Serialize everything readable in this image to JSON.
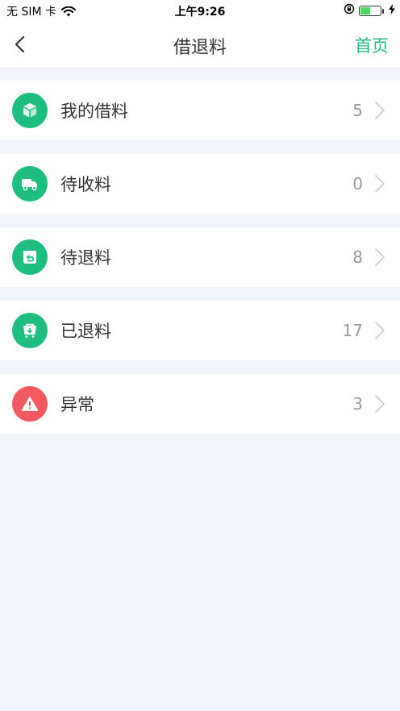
{
  "status_bar": {
    "carrier": "无 SIM 卡",
    "time": "上午9:26",
    "battery_level": 0.55
  },
  "nav": {
    "title": "借退料",
    "home_label": "首页"
  },
  "colors": {
    "accent": "#1fbd7f",
    "danger": "#f25a61"
  },
  "items": [
    {
      "label": "我的借料",
      "count": "5",
      "icon": "box-icon"
    },
    {
      "label": "待收料",
      "count": "0",
      "icon": "truck-icon"
    },
    {
      "label": "待退料",
      "count": "8",
      "icon": "return-icon"
    },
    {
      "label": "已退料",
      "count": "17",
      "icon": "cart-icon"
    },
    {
      "label": "异常",
      "count": "3",
      "icon": "warning-icon"
    }
  ]
}
